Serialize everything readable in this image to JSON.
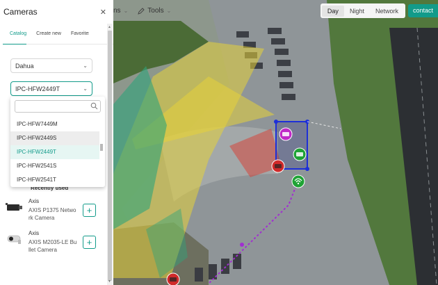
{
  "sidebar": {
    "title": "Cameras",
    "tabs": [
      {
        "label": "Catalog",
        "active": true
      },
      {
        "label": "Create new",
        "active": false
      },
      {
        "label": "Favorites",
        "active": false
      }
    ],
    "brand_select": {
      "value": "Dahua"
    },
    "model_select": {
      "value": "IPC-HFW2449T"
    },
    "dropdown": {
      "search_placeholder": "",
      "options": [
        {
          "label": "IPC-HFW7449M",
          "state": "normal"
        },
        {
          "label": "IPC-HFW2449S",
          "state": "hover"
        },
        {
          "label": "IPC-HFW2449T",
          "state": "selected"
        },
        {
          "label": "IPC-HFW2541S",
          "state": "normal"
        },
        {
          "label": "IPC-HFW2541T",
          "state": "normal"
        }
      ]
    },
    "recently_used": {
      "title": "Recently used",
      "items": [
        {
          "brand": "Axis",
          "model": "AXIS P1375 Network Camera",
          "add": "+"
        },
        {
          "brand": "Axis",
          "model": "AXIS M2035-LE Bullet Camera",
          "add": "+"
        }
      ]
    }
  },
  "toolbar": {
    "partial_label": "ns",
    "tools_label": "Tools",
    "time_modes": [
      {
        "label": "Day",
        "active": true
      },
      {
        "label": "Night",
        "active": false
      },
      {
        "label": "Network",
        "active": false
      }
    ],
    "contact_label": "contact"
  },
  "colors": {
    "accent": "#129b8a",
    "fov_yellow": "#e6d23a",
    "fov_green": "#2fa37a",
    "fov_red": "#d6453d",
    "cable_purple": "#a12fd0",
    "selection_blue": "#1d2fd8"
  },
  "icons": {
    "close": "close-icon",
    "chevron": "chevron-down-icon",
    "search": "search-icon",
    "tools": "pencil-icon",
    "camera_pins": [
      "camera-pin-magenta",
      "camera-pin-green",
      "camera-pin-red",
      "wifi-pin-green",
      "camera-pin-red"
    ]
  }
}
